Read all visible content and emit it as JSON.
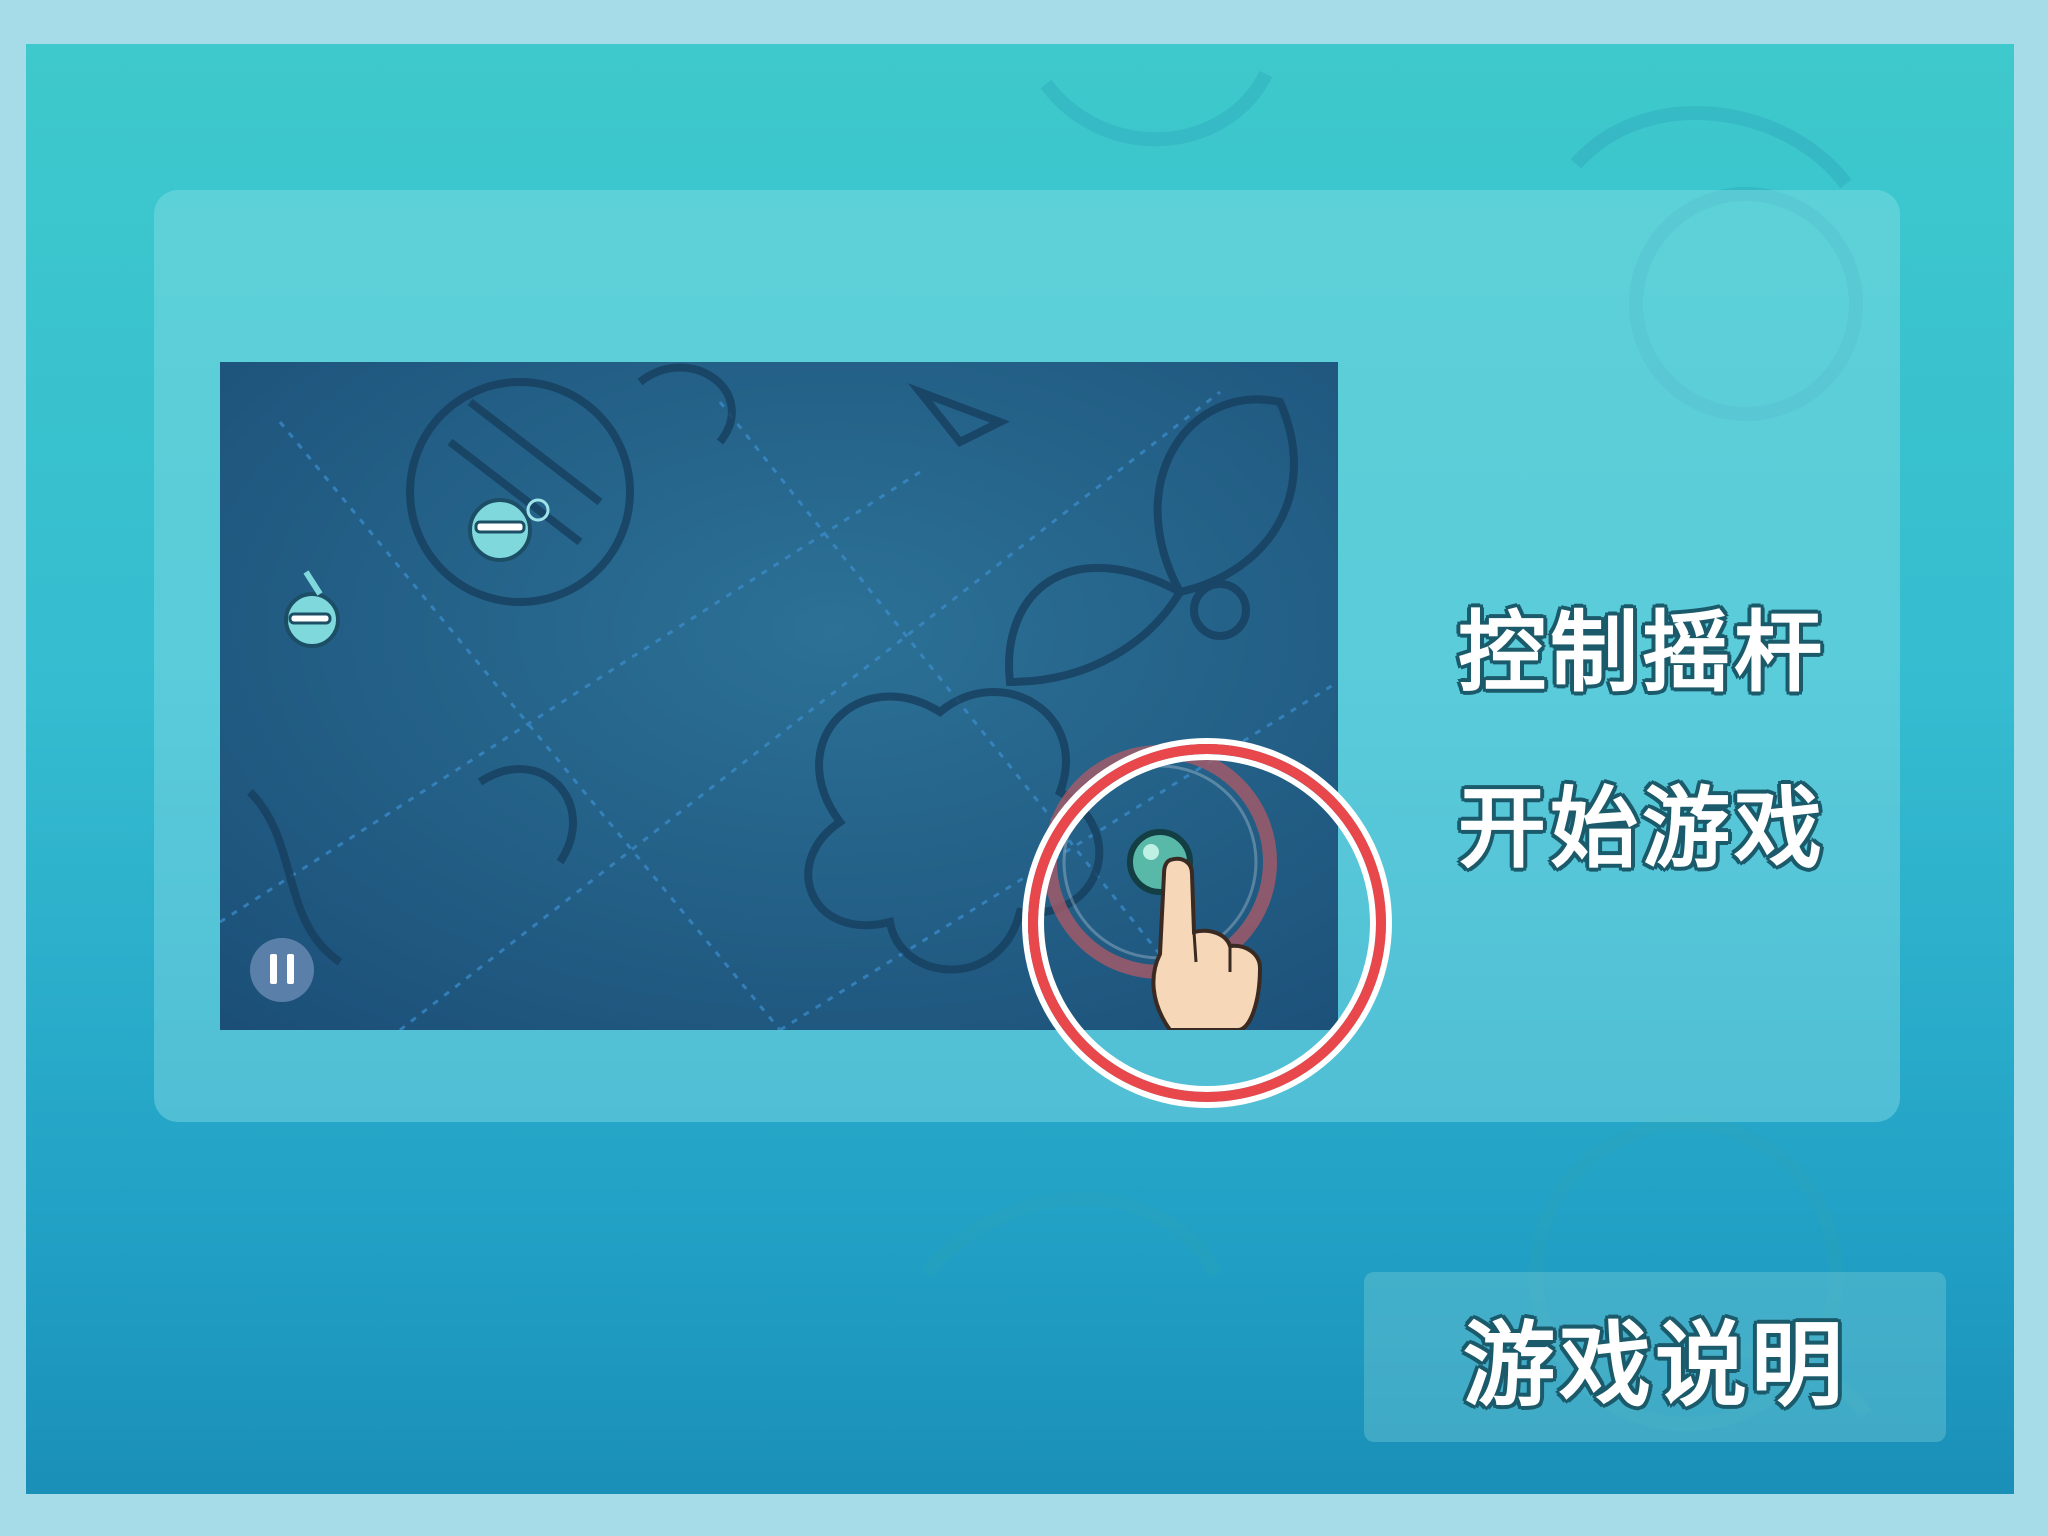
{
  "game": {
    "instructions": {
      "step1": "控制摇杆",
      "step2": "开始游戏"
    },
    "help_button": "游戏说明"
  },
  "icons": {
    "pause": "pause-icon",
    "joystick": "joystick-icon",
    "pointing_hand": "pointing-hand-icon"
  },
  "colors": {
    "highlight_ring": "#e8484c",
    "label_outline": "#1b5a6a",
    "background_top": "#3ec9cc",
    "background_bottom": "#1a8fb8"
  }
}
